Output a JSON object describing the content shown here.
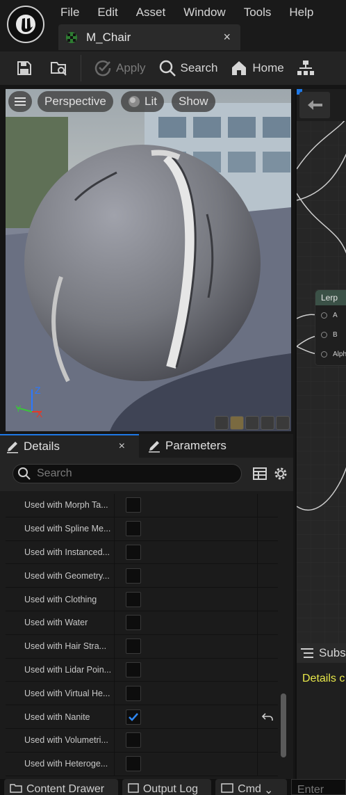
{
  "menu": {
    "items": [
      "File",
      "Edit",
      "Asset",
      "Window",
      "Tools",
      "Help"
    ]
  },
  "asset_tab": {
    "label": "M_Chair",
    "close": "×",
    "icon": "material-icon"
  },
  "toolbar": {
    "apply_label": "Apply",
    "search_label": "Search",
    "home_label": "Home",
    "icons": [
      "save-icon",
      "browse-icon",
      "apply-check-icon",
      "search-icon",
      "home-icon",
      "hierarchy-icon"
    ]
  },
  "viewport": {
    "perspective_label": "Perspective",
    "lit_label": "Lit",
    "show_label": "Show",
    "axis_z": "Z",
    "axis_x": "X",
    "axis_y": "Y"
  },
  "graph": {
    "node_title": "Lerp",
    "pins": [
      "A",
      "B",
      "Alph"
    ]
  },
  "subs_panel": {
    "tab_label": "Subs",
    "message": "Details c"
  },
  "details": {
    "tab_label": "Details",
    "tab_close": "×",
    "parameters_label": "Parameters",
    "search_placeholder": "Search",
    "properties": [
      {
        "label": "Used with Morph Ta...",
        "checked": false,
        "reset": false
      },
      {
        "label": "Used with Spline Me...",
        "checked": false,
        "reset": false
      },
      {
        "label": "Used with Instanced...",
        "checked": false,
        "reset": false
      },
      {
        "label": "Used with Geometry...",
        "checked": false,
        "reset": false
      },
      {
        "label": "Used with Clothing",
        "checked": false,
        "reset": false
      },
      {
        "label": "Used with Water",
        "checked": false,
        "reset": false
      },
      {
        "label": "Used with Hair Stra...",
        "checked": false,
        "reset": false
      },
      {
        "label": "Used with Lidar Poin...",
        "checked": false,
        "reset": false
      },
      {
        "label": "Used with Virtual He...",
        "checked": false,
        "reset": false
      },
      {
        "label": "Used with Nanite",
        "checked": true,
        "reset": true
      },
      {
        "label": "Used with Volumetri...",
        "checked": false,
        "reset": false
      },
      {
        "label": "Used with Heteroge...",
        "checked": false,
        "reset": false
      }
    ]
  },
  "bottom_bar": {
    "content_drawer": "Content Drawer",
    "output_log": "Output Log",
    "cmd": "Cmd",
    "cmd_placeholder": "Enter"
  },
  "colors": {
    "accent": "#1e78e6",
    "subs_message": "#e8e84a",
    "node_header": "#3b5147"
  }
}
